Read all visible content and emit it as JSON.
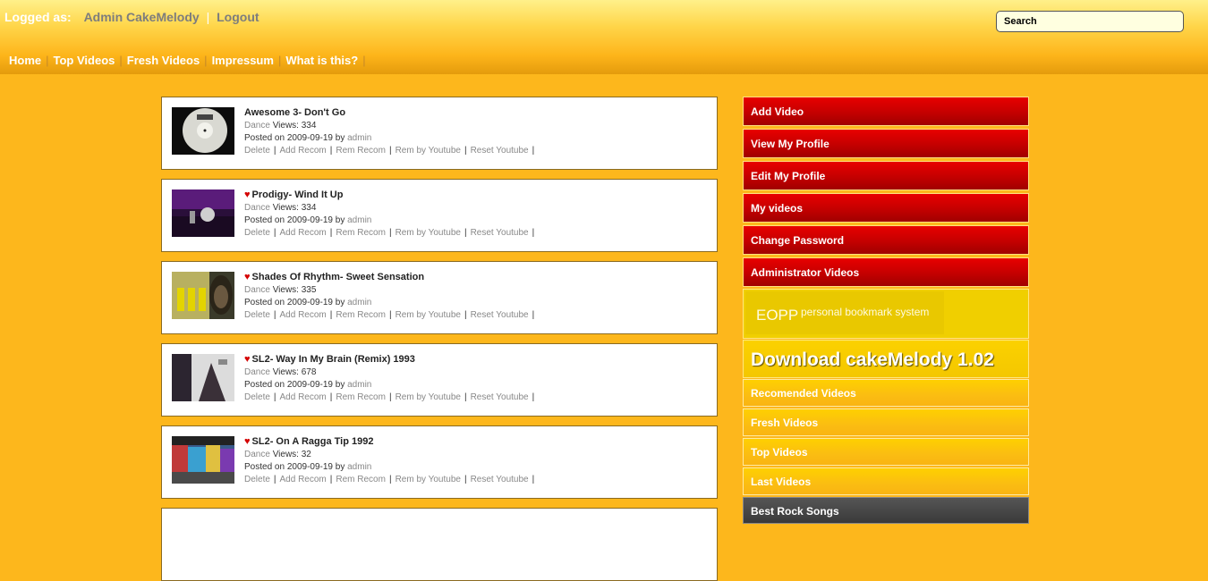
{
  "header": {
    "logged_as_label": "Logged as:",
    "user_name": "Admin CakeMelody",
    "separator": "|",
    "logout_label": "Logout",
    "search_placeholder": "Search"
  },
  "nav": [
    {
      "label": "Home"
    },
    {
      "label": "Top Videos"
    },
    {
      "label": "Fresh Videos"
    },
    {
      "label": "Impressum"
    },
    {
      "label": "What is this?"
    }
  ],
  "videos": [
    {
      "title": "Awesome 3- Don't Go",
      "recommended": false,
      "genre": "Dance",
      "views_label": "Views:",
      "views": "334",
      "posted_label": "Posted on",
      "date": "2009-09-19",
      "by_label": "by",
      "author": "admin"
    },
    {
      "title": "Prodigy- Wind It Up",
      "recommended": true,
      "genre": "Dance",
      "views_label": "Views:",
      "views": "334",
      "posted_label": "Posted on",
      "date": "2009-09-19",
      "by_label": "by",
      "author": "admin"
    },
    {
      "title": "Shades Of Rhythm- Sweet Sensation",
      "recommended": true,
      "genre": "Dance",
      "views_label": "Views:",
      "views": "335",
      "posted_label": "Posted on",
      "date": "2009-09-19",
      "by_label": "by",
      "author": "admin"
    },
    {
      "title": "SL2- Way In My Brain (Remix) 1993",
      "recommended": true,
      "genre": "Dance",
      "views_label": "Views:",
      "views": "678",
      "posted_label": "Posted on",
      "date": "2009-09-19",
      "by_label": "by",
      "author": "admin"
    },
    {
      "title": "SL2- On A Ragga Tip 1992",
      "recommended": true,
      "genre": "Dance",
      "views_label": "Views:",
      "views": "32",
      "posted_label": "Posted on",
      "date": "2009-09-19",
      "by_label": "by",
      "author": "admin"
    }
  ],
  "video_actions": [
    "Delete",
    "Add Recom",
    "Rem Recom",
    "Rem by Youtube",
    "Reset Youtube"
  ],
  "sidebar": {
    "admin_menu": [
      {
        "label": "Add Video"
      },
      {
        "label": "View My Profile"
      },
      {
        "label": "Edit My Profile"
      },
      {
        "label": "My videos"
      },
      {
        "label": "Change Password"
      },
      {
        "label": "Administrator Videos"
      }
    ],
    "eopp": {
      "name": "EOPP",
      "tagline": "personal bookmark system"
    },
    "download_label": "Download cakeMelody 1.02",
    "lists": [
      {
        "label": "Recomended Videos"
      },
      {
        "label": "Fresh Videos"
      },
      {
        "label": "Top Videos"
      },
      {
        "label": "Last Videos"
      }
    ],
    "bottom_label": "Best Rock Songs"
  },
  "colors": {
    "background": "#fdb71c",
    "menu_red": "#d00000",
    "menu_yellow": "#fed000",
    "heart": "#d40000"
  }
}
